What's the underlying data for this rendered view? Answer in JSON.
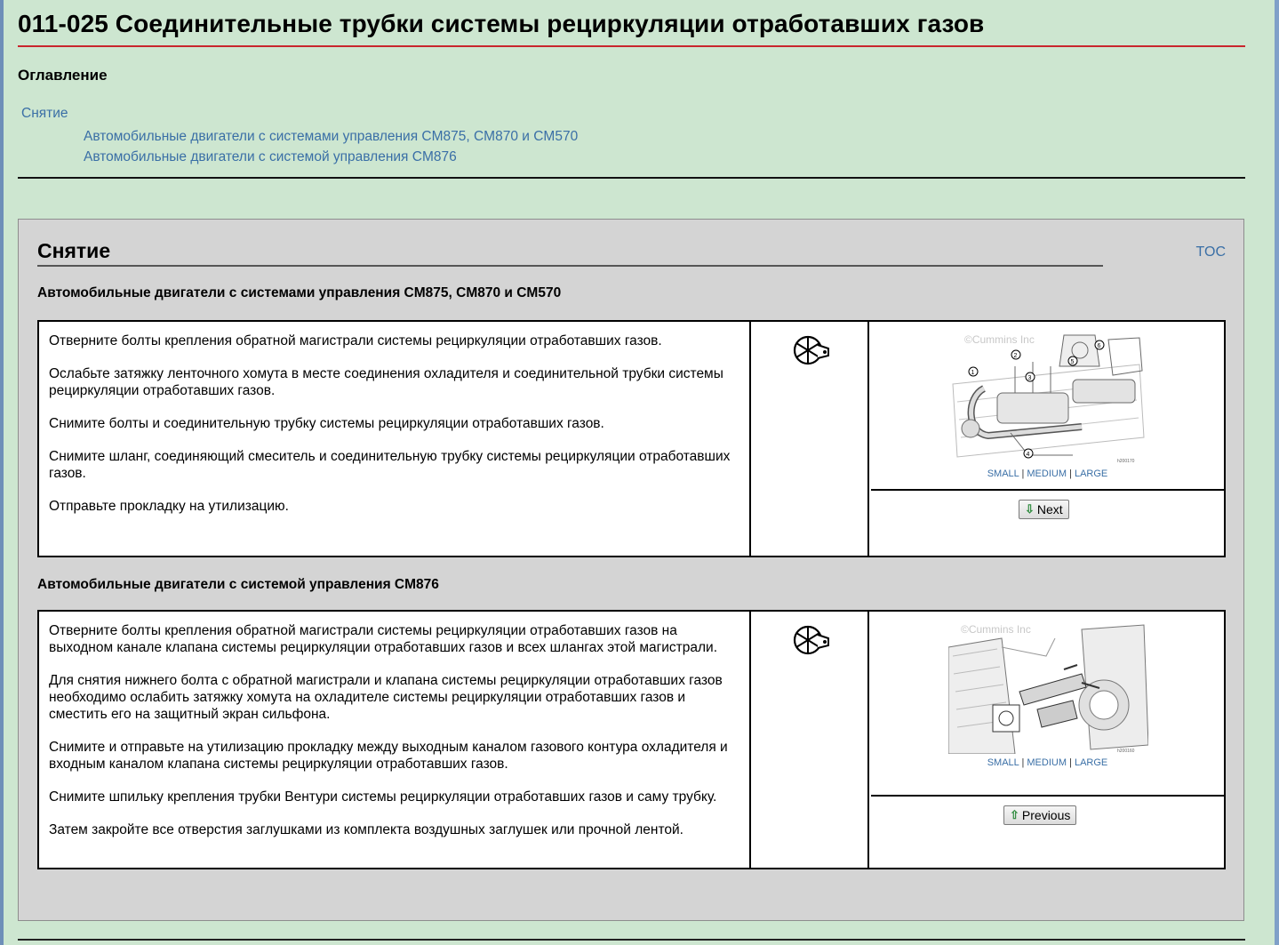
{
  "page": {
    "title": "011-025   Соединительные трубки системы рециркуляции отработавших газов"
  },
  "toc": {
    "heading": "Оглавление",
    "removal": "Снятие",
    "sub1": "Автомобильные двигатели с системами управления CM875, CM870 и CM570",
    "sub2": "Автомобильные двигатели с системой управления CM876"
  },
  "section": {
    "title": "Снятие",
    "toc_link": "TOC",
    "block1": {
      "heading": "Автомобильные двигатели с системами управления CM875, CM870 и CM570",
      "steps": [
        "Отверните болты крепления обратной магистрали системы рециркуляции отработавших газов.",
        "Ослабьте затяжку ленточного хомута в месте соединения охладителя и соединительной трубки системы рециркуляции отработавших газов.",
        "Снимите болты и соединительную трубку системы рециркуляции отработавших газов.",
        "Снимите шланг, соединяющий смеситель и соединительную трубку системы рециркуляции отработавших газов.",
        "Отправьте прокладку на утилизацию."
      ],
      "tool_icon": "wrench-socket-icon",
      "image_watermark": "©Cummins Inc",
      "image_id": "h200170",
      "callouts": [
        "1",
        "2",
        "3",
        "4",
        "5",
        "6"
      ],
      "sizes": {
        "small": "SMALL",
        "medium": "MEDIUM",
        "large": "LARGE",
        "sep": "|"
      },
      "nav_label": "Next"
    },
    "block2": {
      "heading": "Автомобильные двигатели с системой управления CM876",
      "steps": [
        "Отверните болты крепления обратной магистрали системы рециркуляции отработавших газов на выходном канале клапана системы рециркуляции отработавших газов и всех шлангах этой магистрали.",
        "Для снятия нижнего болта с обратной магистрали и клапана системы рециркуляции отработавших газов необходимо ослабить затяжку хомута на охладителе системы рециркуляции отработавших газов и сместить его на защитный экран сильфона.",
        "Снимите и отправьте на утилизацию прокладку между выходным каналом газового контура охладителя и входным каналом клапана системы рециркуляции отработавших газов.",
        "Снимите шпильку крепления трубки Вентури системы рециркуляции отработавших газов и саму трубку.",
        "Затем закройте все отверстия заглушками из комплекта воздушных заглушек или прочной лентой."
      ],
      "tool_icon": "wrench-socket-icon",
      "image_watermark": "©Cummins Inc",
      "image_id": "h200160",
      "sizes": {
        "small": "SMALL",
        "medium": "MEDIUM",
        "large": "LARGE",
        "sep": "|"
      },
      "nav_label": "Previous"
    }
  },
  "colors": {
    "background": "#cde6d0",
    "title_rule": "#c9262d",
    "link": "#3a6fa6",
    "section_bg": "#d4d4d4"
  }
}
